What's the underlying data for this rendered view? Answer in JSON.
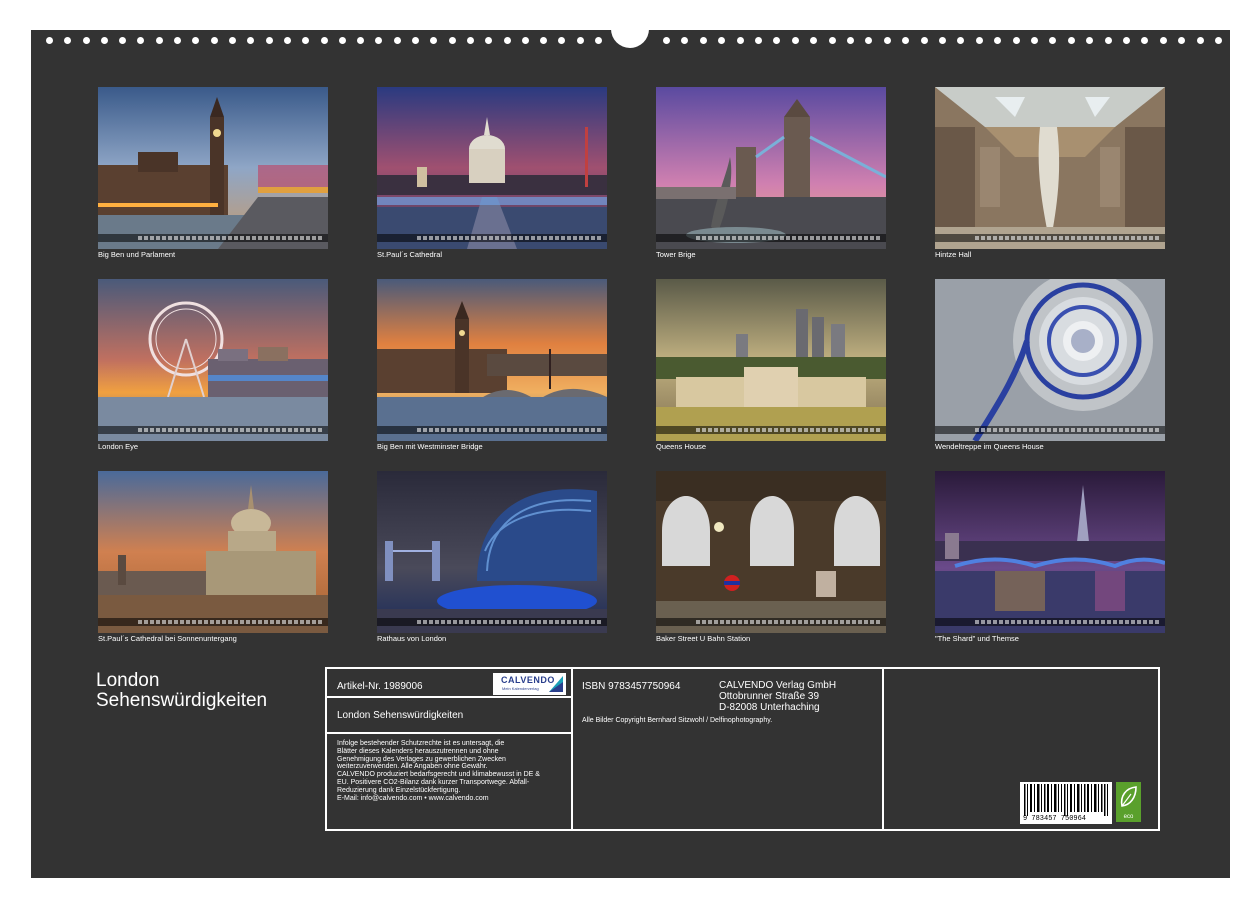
{
  "photos": [
    {
      "caption": "Big Ben und Parlament"
    },
    {
      "caption": "St.Paul´s Cathedral"
    },
    {
      "caption": "Tower Brige"
    },
    {
      "caption": "Hintze Hall"
    },
    {
      "caption": "London Eye"
    },
    {
      "caption": "Big Ben mit Westminster Bridge"
    },
    {
      "caption": "Queens House"
    },
    {
      "caption": "Wendeltreppe im Queens House"
    },
    {
      "caption": "St.Paul´s Cathedral bei Sonnenuntergang"
    },
    {
      "caption": "Rathaus von London"
    },
    {
      "caption": "Baker Street U Bahn Station"
    },
    {
      "caption": "\"The Shard\" und Themse"
    }
  ],
  "calendar_title": {
    "line1": "London",
    "line2": "Sehenswürdigkeiten"
  },
  "info": {
    "article_number": "Artikel-Nr. 1989006",
    "product_title": "London Sehenswürdigkeiten",
    "isbn": "ISBN 9783457750964",
    "publisher_name": "CALVENDO Verlag GmbH",
    "publisher_street": "Ottobrunner Straße 39",
    "publisher_city": "D-82008 Unterhaching",
    "copyright": "Alle Bilder Copyright Bernhard Sitzwohl / Delfinophotography.",
    "legal_lines": [
      "Infolge bestehender Schutzrechte ist es untersagt, die",
      "Blätter dieses Kalenders herauszutrennen und ohne",
      "Genehmigung des Verlages zu gewerblichen Zwecken",
      "weiterzuverwenden. Alle Angaben ohne Gewähr.",
      "CALVENDO produziert bedarfsgerecht und klimabewusst in DE &",
      "EU. Positivere CO2-Bilanz dank kurzer Transportwege. Abfall-",
      "Reduzierung dank Einzelstückfertigung.",
      "E-Mail: info@calvendo.com • www.calvendo.com"
    ],
    "logo_name": "CALVENDO",
    "logo_tagline": "Mein Kalenderverlag",
    "barcode_digits": "9 783457 750964",
    "eco_label": "eco"
  },
  "colors": {
    "background": "#333333",
    "text": "#ffffff",
    "brand": "#2a3f8c",
    "eco": "#5aa02c"
  }
}
